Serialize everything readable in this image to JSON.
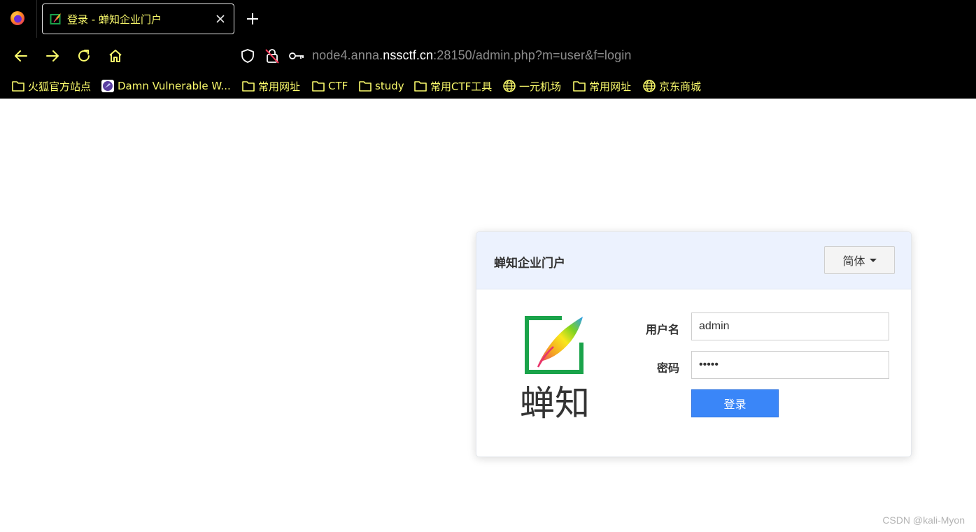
{
  "browser": {
    "tab": {
      "title": "登录 - 蝉知企业门户"
    },
    "url": {
      "prefix": "node4.anna.",
      "host": "nssctf.cn",
      "suffix": ":28150/admin.php?m=user&f=login"
    },
    "bookmarks": [
      {
        "label": "火狐官方站点",
        "icon": "folder-icon"
      },
      {
        "label": "Damn Vulnerable W...",
        "icon": "dvwa-icon"
      },
      {
        "label": "常用网址",
        "icon": "folder-icon"
      },
      {
        "label": "CTF",
        "icon": "folder-icon"
      },
      {
        "label": "study",
        "icon": "folder-icon"
      },
      {
        "label": "常用CTF工具",
        "icon": "folder-icon"
      },
      {
        "label": "一元机场",
        "icon": "globe-icon"
      },
      {
        "label": "常用网址",
        "icon": "folder-icon"
      },
      {
        "label": "京东商城",
        "icon": "globe-icon"
      }
    ],
    "colors": {
      "chrome_bg": "#000000",
      "accent_text": "#fbfb6c"
    }
  },
  "login": {
    "title": "蝉知企业门户",
    "language": "简体",
    "username_label": "用户名",
    "username_value": "admin",
    "password_label": "密码",
    "password_value": "12345",
    "submit_label": "登录",
    "logo_text": "蝉知",
    "colors": {
      "header_bg": "#ecf2fe",
      "button": "#3a86f8",
      "logo_frame": "#1aa34a"
    }
  },
  "watermark": "CSDN @kali-Myon"
}
